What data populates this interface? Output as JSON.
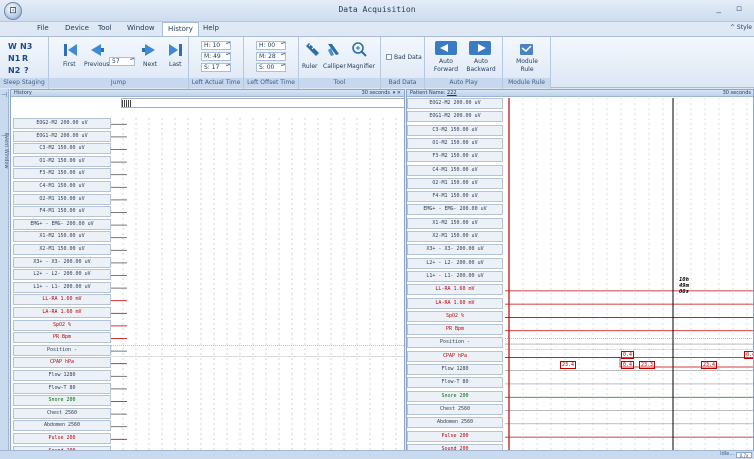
{
  "title": "Data Acquisition",
  "window_controls": "_ ▫",
  "menu": [
    "File",
    "Device",
    "Tool",
    "Window",
    "History",
    "Help"
  ],
  "menu_active": "History",
  "style_label": "^ Style",
  "ribbon": {
    "sleep_staging": {
      "w": "W",
      "n3": "N3",
      "n1": "N1",
      "r": "R",
      "n2": "N2",
      "q": "?",
      "label": "Sleep Staging"
    },
    "jump": {
      "first": "First",
      "previous": "Previous",
      "page_value": "57",
      "next": "Next",
      "last": "Last",
      "label": "Jump"
    },
    "actual_time": {
      "h": "H: 10",
      "m": "M: 49",
      "s": "S: 17",
      "label": "Left Actual Time"
    },
    "offset_time": {
      "h": "H: 00",
      "m": "M: 28",
      "s": "S: 00",
      "label": "Left Offset Time"
    },
    "tool": {
      "ruler": "Ruler",
      "calliper": "Calliper",
      "magnifier": "Magnifier",
      "label": "Tool"
    },
    "bad_data": {
      "checkbox": "Bad Data",
      "label": "Bad Data"
    },
    "auto_play": {
      "forward": "Auto Forward",
      "backward": "Auto Backward",
      "label": "Auto Play"
    },
    "module_rule": {
      "button": "Module Rule",
      "label": "Module Rule"
    }
  },
  "side_strip": "Event Window",
  "history_panel": {
    "title": "History",
    "seconds": "30 seconds",
    "close": "▾ ✕",
    "channels": [
      {
        "label": "EOG2-M2  200.00 uV",
        "color": "normal"
      },
      {
        "label": "EOG1-M2  200.00 uV",
        "color": "normal"
      },
      {
        "label": "C3-M2  150.00 uV",
        "color": "normal"
      },
      {
        "label": "O1-M2  150.00 uV",
        "color": "normal"
      },
      {
        "label": "F3-M2  150.00 uV",
        "color": "normal"
      },
      {
        "label": "C4-M1  150.00 uV",
        "color": "normal"
      },
      {
        "label": "O2-M1  150.00 uV",
        "color": "normal"
      },
      {
        "label": "F4-M1  150.00 uV",
        "color": "normal"
      },
      {
        "label": "EMG+ - EMG-  200.00 uV",
        "color": "normal"
      },
      {
        "label": "X1-M2  150.00 uV",
        "color": "normal"
      },
      {
        "label": "X2-M1  150.00 uV",
        "color": "normal"
      },
      {
        "label": "X3+ - X3-  200.00 uV",
        "color": "normal"
      },
      {
        "label": "L2+ - L2-  200.00 uV",
        "color": "normal"
      },
      {
        "label": "L1+ - L1-  200.00 uV",
        "color": "normal"
      },
      {
        "label": "LL-RA  1.60 mV",
        "color": "red"
      },
      {
        "label": "LA-RA  1.60 mV",
        "color": "red"
      },
      {
        "label": "SpO2  %",
        "color": "red"
      },
      {
        "label": "PR  Bpm",
        "color": "red"
      },
      {
        "label": "Position  -",
        "color": "normal"
      },
      {
        "label": "CPAP  hPa",
        "color": "red"
      },
      {
        "label": "Flow  1280",
        "color": "normal"
      },
      {
        "label": "Flow-T  80",
        "color": "normal"
      },
      {
        "label": "Snore  200",
        "color": "green"
      },
      {
        "label": "Chest  2560",
        "color": "normal"
      },
      {
        "label": "Abdomen  2560",
        "color": "normal"
      },
      {
        "label": "Pulse  200",
        "color": "red"
      },
      {
        "label": "Sound  200",
        "color": "red"
      }
    ]
  },
  "patient_panel": {
    "title": "Patient Name:",
    "patient": "222",
    "seconds": "30 seconds",
    "timestamp": "10h\n49m\n08s",
    "annotations": [
      "0.4",
      "23.4",
      "0.4",
      "23.3",
      "23.4",
      "0.4"
    ],
    "channels": [
      {
        "label": "EOG2-M2  200.00 uV",
        "color": "normal"
      },
      {
        "label": "EOG1-M2  200.00 uV",
        "color": "normal"
      },
      {
        "label": "C3-M2  150.00 uV",
        "color": "normal"
      },
      {
        "label": "O1-M2  150.00 uV",
        "color": "normal"
      },
      {
        "label": "F3-M2  150.00 uV",
        "color": "normal"
      },
      {
        "label": "C4-M1  150.00 uV",
        "color": "normal"
      },
      {
        "label": "O2-M1  150.00 uV",
        "color": "normal"
      },
      {
        "label": "F4-M1  150.00 uV",
        "color": "normal"
      },
      {
        "label": "EMG+ - EMG-  200.00 uV",
        "color": "normal"
      },
      {
        "label": "X1-M2  150.00 uV",
        "color": "normal"
      },
      {
        "label": "X2-M1  150.00 uV",
        "color": "normal"
      },
      {
        "label": "X3+ - X3-  200.00 uV",
        "color": "normal"
      },
      {
        "label": "L2+ - L2-  200.00 uV",
        "color": "normal"
      },
      {
        "label": "L1+ - L1-  200.00 uV",
        "color": "normal"
      },
      {
        "label": "LL-RA  1.60 mV",
        "color": "red"
      },
      {
        "label": "LA-RA  1.60 mV",
        "color": "red"
      },
      {
        "label": "SpO2  %",
        "color": "red"
      },
      {
        "label": "PR  Bpm",
        "color": "red"
      },
      {
        "label": "Position  -",
        "color": "normal"
      },
      {
        "label": "CPAP  hPa",
        "color": "red"
      },
      {
        "label": "Flow  1280",
        "color": "normal"
      },
      {
        "label": "Flow-T  80",
        "color": "normal"
      },
      {
        "label": "Snore  200",
        "color": "green"
      },
      {
        "label": "Chest  2560",
        "color": "normal"
      },
      {
        "label": "Abdomen  2560",
        "color": "normal"
      },
      {
        "label": "Pulse  200",
        "color": "red"
      },
      {
        "label": "Sound  200",
        "color": "red"
      }
    ]
  },
  "status": {
    "text": "Idle...",
    "zoom": "0.7x"
  },
  "colors": {
    "accent": "#1e395b",
    "red": "#c00000",
    "green": "#006a00",
    "cursor": "#000000",
    "ribbon": "#dce7f5"
  }
}
